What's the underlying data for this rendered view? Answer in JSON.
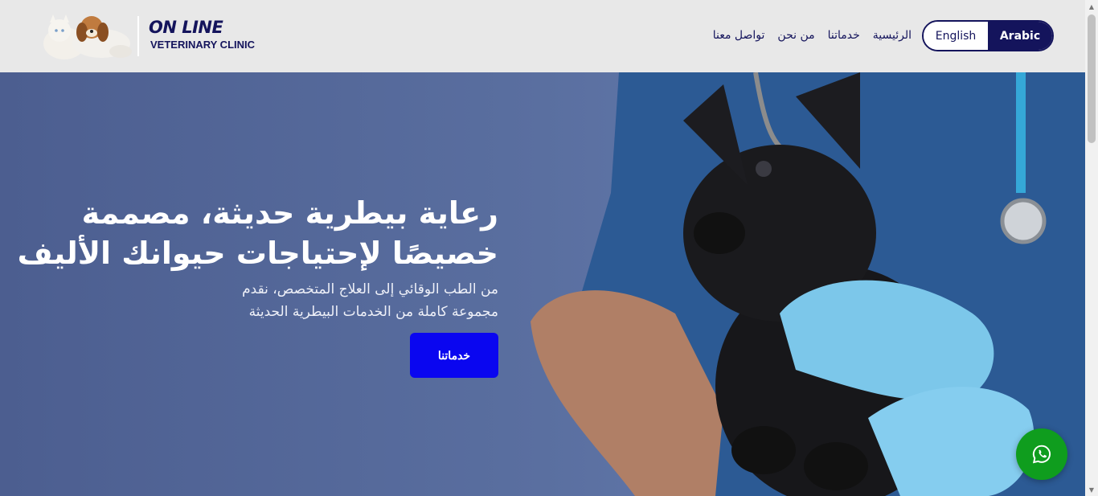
{
  "header": {
    "logo_title": "ON LINE",
    "logo_subtitle": "VETERINARY CLINIC",
    "nav": [
      {
        "label": "الرئيسية"
      },
      {
        "label": "خدماتنا"
      },
      {
        "label": "من نحن"
      },
      {
        "label": "تواصل معنا"
      }
    ],
    "lang_english": "English",
    "lang_arabic": "Arabic"
  },
  "hero": {
    "title": "رعاية بيطرية حديثة، مصممة خصيصًا لإحتياجات حيوانك الأليف",
    "subtitle": "من الطب الوقائي إلى العلاج المتخصص، نقدم مجموعة كاملة من الخدمات البيطرية الحديثة",
    "cta_label": "خدماتنا"
  },
  "colors": {
    "brand": "#14145c",
    "cta": "#0a06f0",
    "whatsapp": "#0f9d1e"
  },
  "icons": {
    "whatsapp": "whatsapp-icon"
  }
}
